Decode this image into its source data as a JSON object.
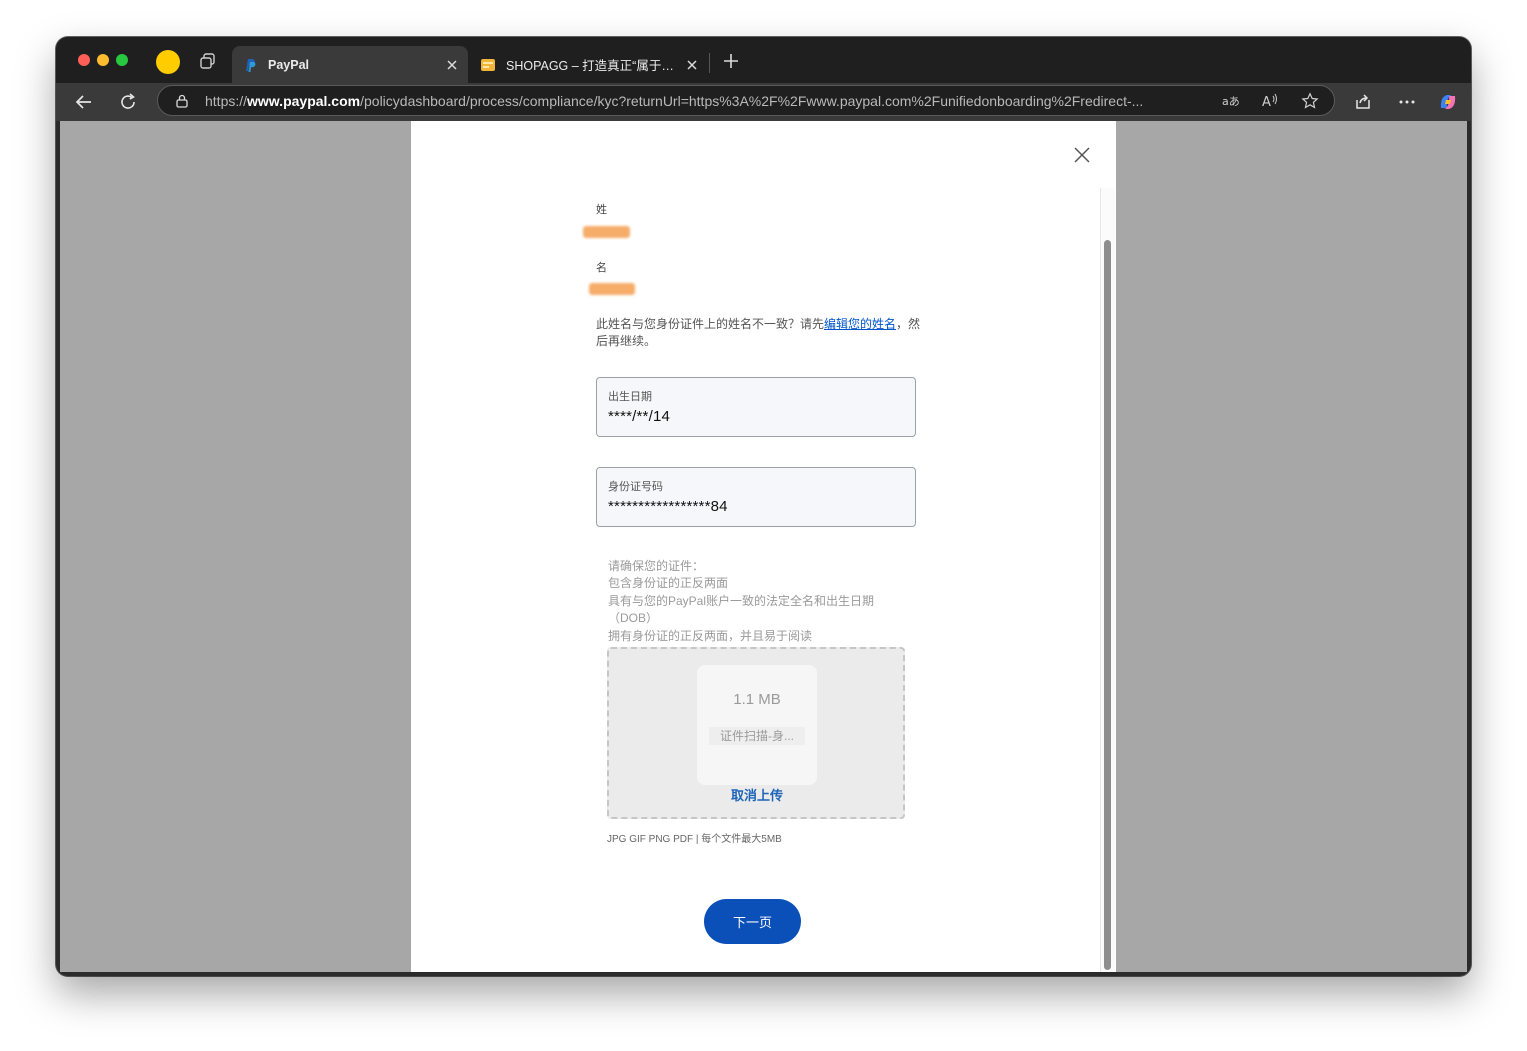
{
  "browser": {
    "tabs": [
      {
        "title": "PayPal",
        "active": true
      },
      {
        "title": "SHOPAGG – 打造真正“属于你的”",
        "active": false
      }
    ],
    "url": {
      "prefix": "https://",
      "domain": "www.paypal.com",
      "path": "/policydashboard/process/compliance/kyc?returnUrl=https%3A%2F%2Fwww.paypal.com%2Funifiedonboarding%2Fredirect-..."
    },
    "icons": {
      "back": "arrow-left-icon",
      "reload": "reload-icon",
      "lock": "lock-icon",
      "translate": "translate-icon",
      "read_aloud": "read-aloud-icon",
      "favorite": "star-icon",
      "share": "share-icon",
      "more": "more-icon",
      "copilot": "copilot-icon"
    },
    "colors": {
      "tabstrip": "#1f1f1f",
      "toolbar": "#3a3a3a"
    }
  },
  "form": {
    "last_name_label": "姓",
    "first_name_label": "名",
    "notice_text": "此姓名与您身份证件上的姓名不一致？请先",
    "notice_link": "编辑您的姓名",
    "notice_suffix": "，然后再继续。",
    "dob_label": "出生日期",
    "dob_value": "****/**/14",
    "id_label": "身份证号码",
    "id_value": "*****************84",
    "requirements_title": "请确保您的证件：",
    "requirements": [
      "包含身份证的正反两面",
      "具有与您的PayPal账户一致的法定全名和出生日期（DOB）",
      "拥有身份证的正反两面，并且易于阅读"
    ],
    "upload": {
      "file_size": "1.1 MB",
      "file_name": "证件扫描-身...",
      "cancel_label": "取消上传"
    },
    "file_hint": "JPG GIF PNG PDF | 每个文件最大5MB",
    "next_label": "下一页",
    "colors": {
      "primary_button": "#0b4fb8",
      "link": "#0055cc",
      "redaction": "#f6ad6a"
    }
  }
}
